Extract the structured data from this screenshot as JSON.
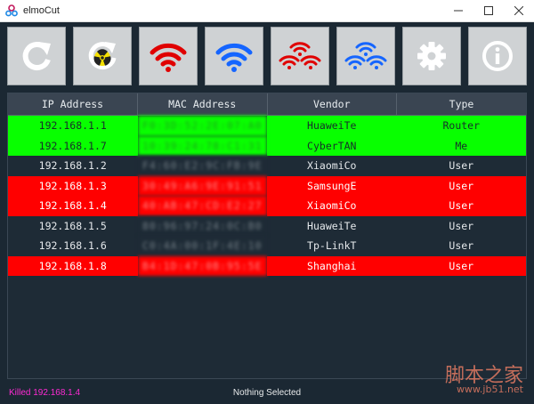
{
  "window": {
    "title": "elmoCut",
    "controls": [
      "minimize-icon",
      "maximize-icon",
      "close-icon"
    ]
  },
  "toolbar": {
    "buttons": [
      {
        "name": "refresh-button",
        "icon": "refresh-icon"
      },
      {
        "name": "nuclear-button",
        "icon": "radiation-icon"
      },
      {
        "name": "kill-all-button",
        "icon": "wifi-red-icon"
      },
      {
        "name": "unkill-all-button",
        "icon": "wifi-blue-icon"
      },
      {
        "name": "kill-multiple-button",
        "icon": "wifi-red-multi-icon"
      },
      {
        "name": "unkill-multiple-button",
        "icon": "wifi-blue-multi-icon"
      },
      {
        "name": "settings-button",
        "icon": "gear-icon"
      },
      {
        "name": "about-button",
        "icon": "info-icon"
      }
    ]
  },
  "table": {
    "columns": [
      "IP Address",
      "MAC Address",
      "Vendor",
      "Type"
    ],
    "rows": [
      {
        "ip": "192.168.1.1",
        "mac": "F0:3D:52:2E:07:A0",
        "vendor": "HuaweiTe",
        "type": "Router",
        "state": "router"
      },
      {
        "ip": "192.168.1.7",
        "mac": "10:39:24:78:C1:31",
        "vendor": "CyberTAN",
        "type": "Me",
        "state": "me"
      },
      {
        "ip": "192.168.1.2",
        "mac": "F4:60:E2:9C:FB:9E",
        "vendor": "XiaomiCo",
        "type": "User",
        "state": "user"
      },
      {
        "ip": "192.168.1.3",
        "mac": "30:49:A6:9E:91:51",
        "vendor": "SamsungE",
        "type": "User",
        "state": "killed"
      },
      {
        "ip": "192.168.1.4",
        "mac": "40:AB:47:CD:E2:27",
        "vendor": "XiaomiCo",
        "type": "User",
        "state": "killed"
      },
      {
        "ip": "192.168.1.5",
        "mac": "80:96:97:24:0C:B0",
        "vendor": "HuaweiTe",
        "type": "User",
        "state": "user"
      },
      {
        "ip": "192.168.1.6",
        "mac": "C0:4A:00:1F:4E:10",
        "vendor": "Tp-LinkT",
        "type": "User",
        "state": "user"
      },
      {
        "ip": "192.168.1.8",
        "mac": "B4:1D:47:0B:95:5E",
        "vendor": "Shanghai",
        "type": "User",
        "state": "killed"
      }
    ]
  },
  "status": {
    "left": "Killed 192.168.1.4",
    "center": "Nothing Selected"
  },
  "watermark": {
    "text": "脚本之家",
    "url": "www.jb51.net"
  },
  "colors": {
    "router_row": "#08ff00",
    "killed_row": "#ff0000",
    "user_row": "#1e2b36",
    "status_left": "#ff2ad4"
  }
}
